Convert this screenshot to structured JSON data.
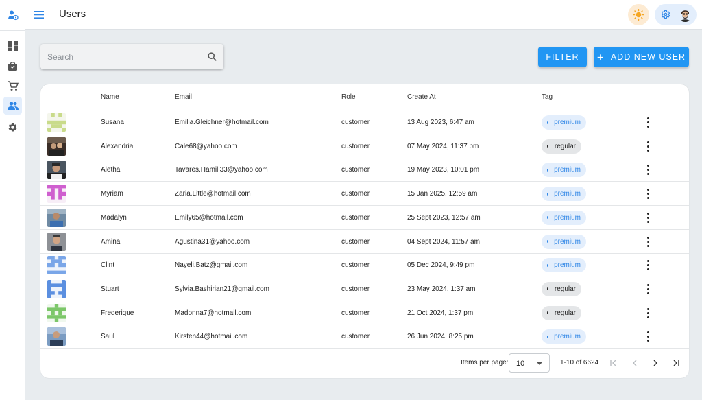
{
  "header": {
    "title": "Users"
  },
  "search": {
    "placeholder": "Search"
  },
  "toolbar": {
    "filter_label": "FILTER",
    "add_label": "ADD NEW USER"
  },
  "table": {
    "columns": [
      "Name",
      "Email",
      "Role",
      "Create At",
      "Tag"
    ],
    "rows": [
      {
        "name": "Susana",
        "email": "Emilia.Gleichner@hotmail.com",
        "role": "customer",
        "created": "13 Aug 2023, 6:47 am",
        "tag": "premium"
      },
      {
        "name": "Alexandria",
        "email": "Cale68@yahoo.com",
        "role": "customer",
        "created": "07 May 2024, 11:37 pm",
        "tag": "regular"
      },
      {
        "name": "Aletha",
        "email": "Tavares.Hamill33@yahoo.com",
        "role": "customer",
        "created": "19 May 2023, 10:01 pm",
        "tag": "premium"
      },
      {
        "name": "Myriam",
        "email": "Zaria.Little@hotmail.com",
        "role": "customer",
        "created": "15 Jan 2025, 12:59 am",
        "tag": "premium"
      },
      {
        "name": "Madalyn",
        "email": "Emily65@hotmail.com",
        "role": "customer",
        "created": "25 Sept 2023, 12:57 am",
        "tag": "premium"
      },
      {
        "name": "Amina",
        "email": "Agustina31@yahoo.com",
        "role": "customer",
        "created": "04 Sept 2024, 11:57 am",
        "tag": "premium"
      },
      {
        "name": "Clint",
        "email": "Nayeli.Batz@gmail.com",
        "role": "customer",
        "created": "05 Dec 2024, 9:49 pm",
        "tag": "premium"
      },
      {
        "name": "Stuart",
        "email": "Sylvia.Bashirian21@gmail.com",
        "role": "customer",
        "created": "23 May 2024, 1:37 am",
        "tag": "regular"
      },
      {
        "name": "Frederique",
        "email": "Madonna7@hotmail.com",
        "role": "customer",
        "created": "21 Oct 2024, 1:37 pm",
        "tag": "regular"
      },
      {
        "name": "Saul",
        "email": "Kirsten44@hotmail.com",
        "role": "customer",
        "created": "26 Jun 2024, 8:25 pm",
        "tag": "premium"
      }
    ]
  },
  "pagination": {
    "items_per_page_label": "Items per page:",
    "items_per_page": "10",
    "range": "1-10 of 6624"
  },
  "colors": {
    "accent": "#2196f3",
    "premium_bg": "#e3eefc",
    "premium_text": "#2f86e6",
    "regular_bg": "#e4e6e8",
    "background": "#e8ecef"
  },
  "icons": [
    "user-logo-icon",
    "dashboard-icon",
    "shopping-bag-icon",
    "cart-icon",
    "users-icon",
    "settings-icon",
    "menu-icon",
    "sun-icon",
    "gear-icon",
    "search-icon",
    "plus-icon",
    "more-vert-icon",
    "first-page-icon",
    "prev-page-icon",
    "next-page-icon",
    "last-page-icon"
  ]
}
